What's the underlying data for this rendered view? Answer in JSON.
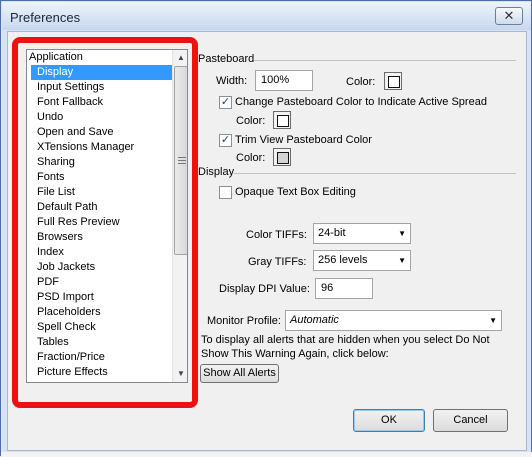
{
  "window": {
    "title": "Preferences",
    "close_glyph": "✕"
  },
  "categories": [
    {
      "label": "Application",
      "level": "header"
    },
    {
      "label": "Display",
      "level": "child",
      "selected": true
    },
    {
      "label": "Input Settings",
      "level": "child"
    },
    {
      "label": "Font Fallback",
      "level": "child"
    },
    {
      "label": "Undo",
      "level": "child"
    },
    {
      "label": "Open and Save",
      "level": "child"
    },
    {
      "label": "XTensions Manager",
      "level": "child"
    },
    {
      "label": "Sharing",
      "level": "child"
    },
    {
      "label": "Fonts",
      "level": "child"
    },
    {
      "label": "File List",
      "level": "child"
    },
    {
      "label": "Default Path",
      "level": "child"
    },
    {
      "label": "Full Res Preview",
      "level": "child"
    },
    {
      "label": "Browsers",
      "level": "child"
    },
    {
      "label": "Index",
      "level": "child"
    },
    {
      "label": "Job Jackets",
      "level": "child"
    },
    {
      "label": "PDF",
      "level": "child"
    },
    {
      "label": "PSD Import",
      "level": "child"
    },
    {
      "label": "Placeholders",
      "level": "child"
    },
    {
      "label": "Spell Check",
      "level": "child"
    },
    {
      "label": "Tables",
      "level": "child"
    },
    {
      "label": "Fraction/Price",
      "level": "child"
    },
    {
      "label": "Picture Effects",
      "level": "child"
    }
  ],
  "pasteboard": {
    "section_label": "Pasteboard",
    "width_label": "Width:",
    "width_value": "100%",
    "color_label": "Color:",
    "change_color_label": "Change Pasteboard Color to Indicate Active Spread",
    "change_color_checked": true,
    "change_color_color_label": "Color:",
    "trim_view_label": "Trim View Pasteboard Color",
    "trim_view_checked": true,
    "trim_view_color_label": "Color:"
  },
  "display": {
    "section_label": "Display",
    "opaque_label": "Opaque Text Box Editing",
    "opaque_checked": false,
    "color_tiffs_label": "Color TIFFs:",
    "color_tiffs_value": "24-bit",
    "gray_tiffs_label": "Gray TIFFs:",
    "gray_tiffs_value": "256 levels",
    "dpi_label": "Display DPI Value:",
    "dpi_value": "96",
    "monitor_label": "Monitor Profile:",
    "monitor_value": "Automatic",
    "alert_text_line1": "To display all alerts that are hidden when you select Do Not",
    "alert_text_line2": "Show This Warning Again, click below:",
    "show_alerts_label": "Show All Alerts"
  },
  "buttons": {
    "ok": "OK",
    "cancel": "Cancel"
  },
  "colors": {
    "selection": "#3399ff",
    "highlight_annotation": "#ee1111"
  }
}
